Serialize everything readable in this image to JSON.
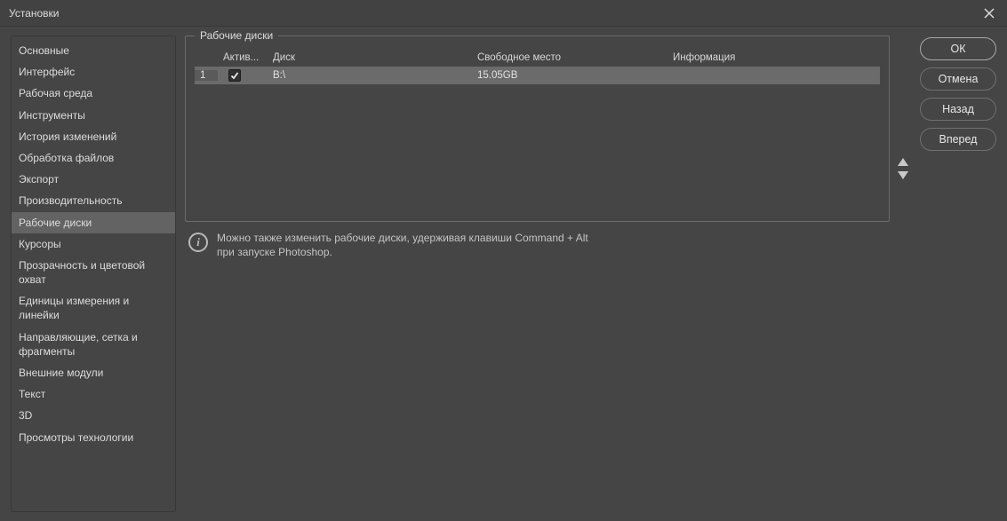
{
  "window": {
    "title": "Установки"
  },
  "sidebar": {
    "items": [
      {
        "label": "Основные"
      },
      {
        "label": "Интерфейс"
      },
      {
        "label": "Рабочая среда"
      },
      {
        "label": "Инструменты"
      },
      {
        "label": "История изменений"
      },
      {
        "label": "Обработка файлов"
      },
      {
        "label": "Экспорт"
      },
      {
        "label": "Производительность"
      },
      {
        "label": "Рабочие диски",
        "selected": true
      },
      {
        "label": "Курсоры"
      },
      {
        "label": "Прозрачность и цветовой охват"
      },
      {
        "label": "Единицы измерения и линейки"
      },
      {
        "label": "Направляющие, сетка и фрагменты"
      },
      {
        "label": "Внешние модули"
      },
      {
        "label": "Текст"
      },
      {
        "label": "3D"
      },
      {
        "label": "Просмотры технологии"
      }
    ]
  },
  "panel": {
    "title": "Рабочие диски",
    "columns": {
      "active": "Актив...",
      "disk": "Диск",
      "free": "Свободное место",
      "info": "Информация"
    },
    "rows": [
      {
        "index": "1",
        "active": true,
        "disk": "B:\\",
        "free": "15.05GB",
        "info": ""
      }
    ]
  },
  "hint": {
    "line1": "Можно также изменить рабочие диски, удерживая клавиши Command + Alt",
    "line2": "при запуске Photoshop."
  },
  "buttons": {
    "ok": "ОК",
    "cancel": "Отмена",
    "prev": "Назад",
    "next": "Вперед"
  }
}
